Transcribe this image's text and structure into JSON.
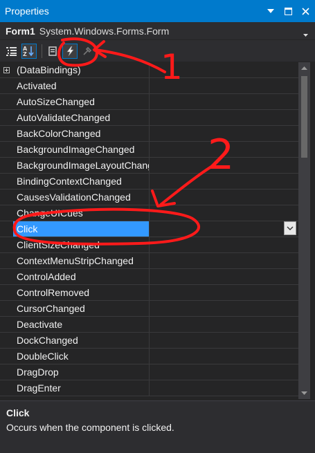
{
  "window": {
    "title": "Properties"
  },
  "object": {
    "name": "Form1",
    "type": "System.Windows.Forms.Form"
  },
  "toolbar": {
    "icons": [
      "categorized-icon",
      "alphabetical-icon",
      "properties-icon",
      "events-icon",
      "property-pages-icon"
    ]
  },
  "grid": {
    "rows": [
      {
        "label": "(DataBindings)"
      },
      {
        "label": "Activated"
      },
      {
        "label": "AutoSizeChanged"
      },
      {
        "label": "AutoValidateChanged"
      },
      {
        "label": "BackColorChanged"
      },
      {
        "label": "BackgroundImageChanged"
      },
      {
        "label": "BackgroundImageLayoutChanged"
      },
      {
        "label": "BindingContextChanged"
      },
      {
        "label": "CausesValidationChanged"
      },
      {
        "label": "ChangeUICues"
      },
      {
        "label": "Click"
      },
      {
        "label": "ClientSizeChanged"
      },
      {
        "label": "ContextMenuStripChanged"
      },
      {
        "label": "ControlAdded"
      },
      {
        "label": "ControlRemoved"
      },
      {
        "label": "CursorChanged"
      },
      {
        "label": "Deactivate"
      },
      {
        "label": "DockChanged"
      },
      {
        "label": "DoubleClick"
      },
      {
        "label": "DragDrop"
      },
      {
        "label": "DragEnter"
      }
    ]
  },
  "description": {
    "title": "Click",
    "text": "Occurs when the component is clicked."
  },
  "annotations": {
    "label1": "1",
    "label2": "2",
    "color": "#ff1a1a"
  },
  "colors": {
    "accent": "#007acc",
    "selection": "#3399ff",
    "background": "#252526"
  }
}
